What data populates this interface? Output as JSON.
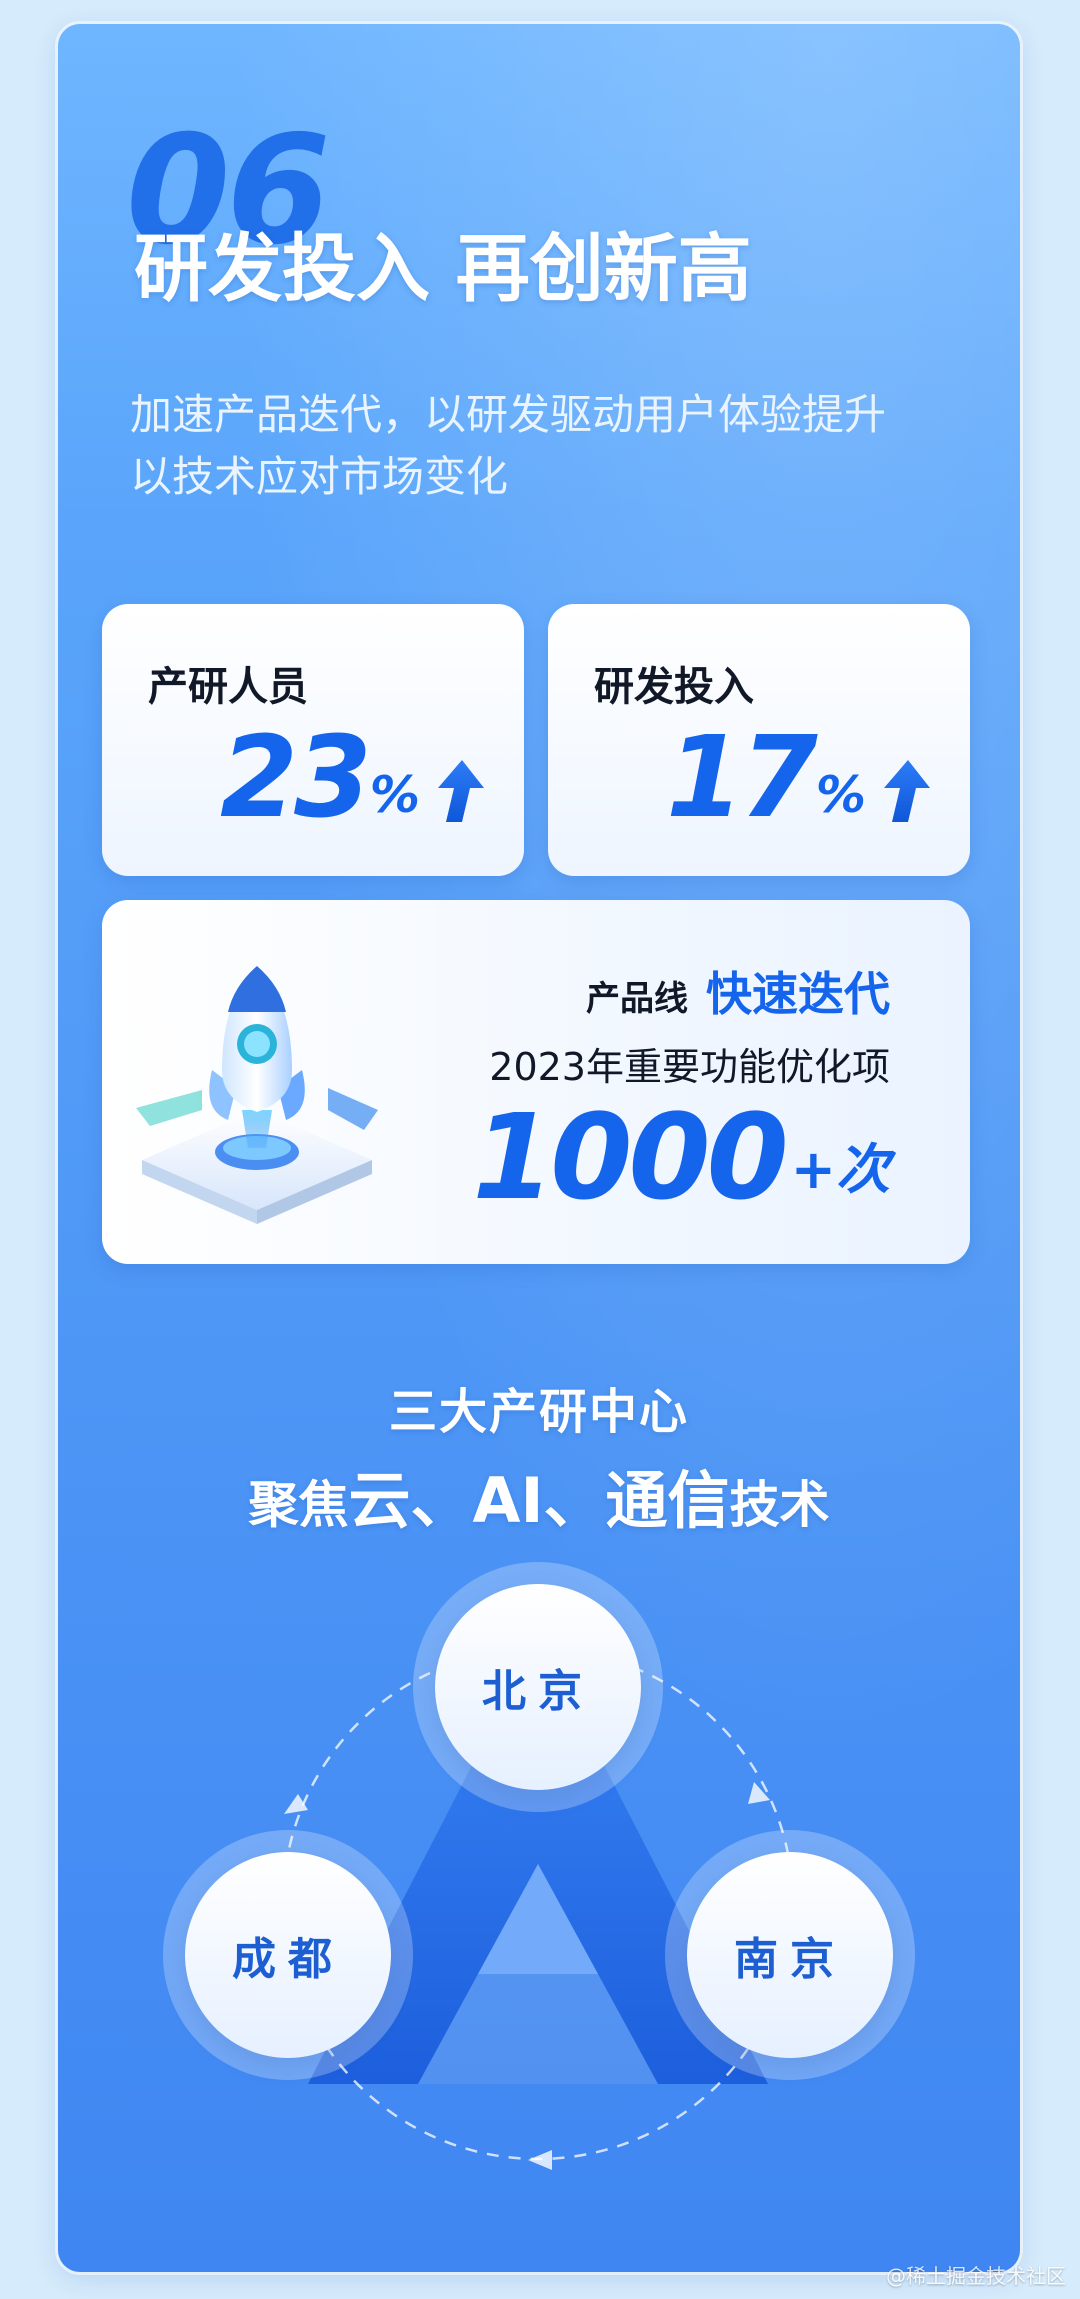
{
  "section": {
    "number": "06",
    "title": "研发投入 再创新高",
    "subtitle_lines": [
      "加速产品迭代，以研发驱动用户体验提升",
      "以技术应对市场变化"
    ]
  },
  "stats": [
    {
      "label": "产研人员",
      "value": "23",
      "unit": "%",
      "trend": "up"
    },
    {
      "label": "研发投入",
      "value": "17",
      "unit": "%",
      "trend": "up"
    }
  ],
  "product": {
    "line_label": "产品线",
    "line_highlight": "快速迭代",
    "description": "2023年重要功能优化项",
    "count": "1000",
    "count_suffix": "+次"
  },
  "centers": {
    "heading": "三大产研中心",
    "subheading_prefix": "聚焦",
    "subheading_focus": "云、AI、通信",
    "subheading_suffix": "技术",
    "cities": [
      "北京",
      "成都",
      "南京"
    ]
  },
  "colors": {
    "accent_blue": "#1464ec",
    "card_gradient_top": "#6fb6ff",
    "card_gradient_bottom": "#3f86f2"
  },
  "watermark": "@稀土掘金技术社区"
}
